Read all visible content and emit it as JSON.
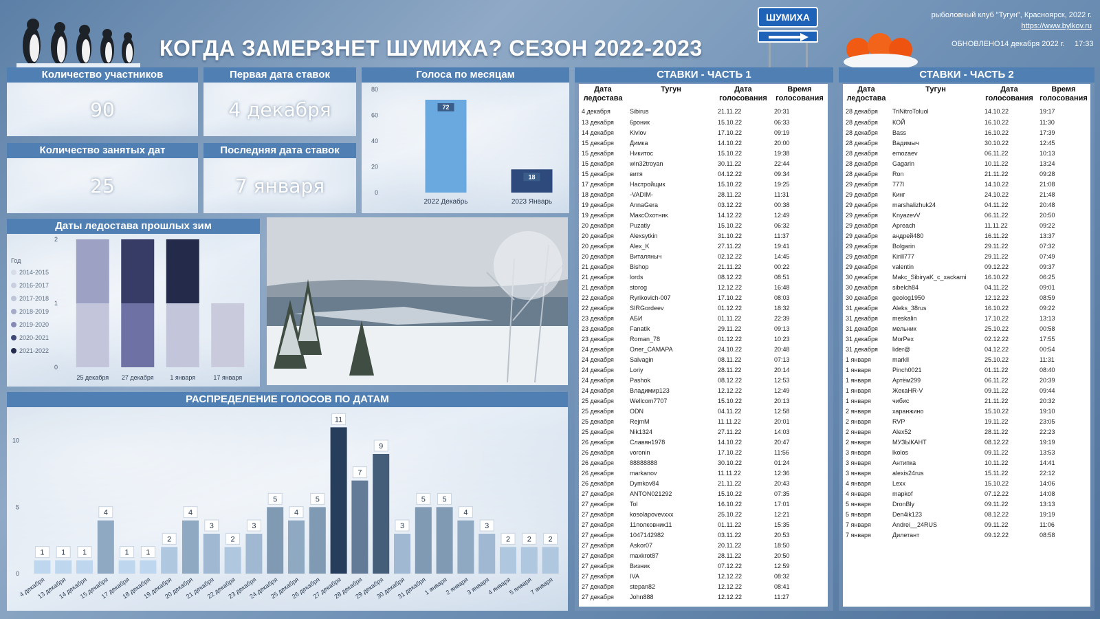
{
  "header": {
    "title": "КОГДА ЗАМЕРЗНЕТ ШУМИХА? СЕЗОН 2022-2023",
    "sign_label": "ШУМИХА",
    "club": "рыболовный клуб \"Тугун\", Красноярск, 2022 г.",
    "site": "https://www.bylkov.ru",
    "updated_label": "ОБНОВЛЕНО",
    "updated_date": "14 декабря 2022 г.",
    "updated_time": "17:33"
  },
  "kpis": {
    "participants_label": "Количество участников",
    "participants_value": "90",
    "first_date_label": "Первая дата ставок",
    "first_date_value": "4 декабря",
    "occupied_label": "Количество занятых дат",
    "occupied_value": "25",
    "last_date_label": "Последняя дата ставок",
    "last_date_value": "7 января"
  },
  "colors": {
    "header_blue": "#4f7fb3",
    "bar_light": "#6aa9e0",
    "bar_dark": "#2e4a7c"
  },
  "chart_data": [
    {
      "type": "bar",
      "title": "Голоса по месяцам",
      "categories": [
        "2022 Декабрь",
        "2023 Январь"
      ],
      "values": [
        72,
        18
      ],
      "ylim": [
        0,
        80
      ],
      "yticks": [
        0,
        20,
        40,
        60,
        80
      ],
      "colors": [
        "#6aa9e0",
        "#2e4a7c"
      ]
    },
    {
      "type": "bar",
      "title": "Даты ледостава прошлых зим",
      "stacked": true,
      "legend_title": "Год",
      "legend": [
        "2014-2015",
        "2016-2017",
        "2017-2018",
        "2018-2019",
        "2019-2020",
        "2020-2021",
        "2021-2022"
      ],
      "legend_colors": [
        "#d7dce6",
        "#c9cfde",
        "#bfc5d8",
        "#a5abc8",
        "#8689b4",
        "#3e4a78",
        "#242c4c"
      ],
      "categories": [
        "25 декабря",
        "27 декабря",
        "1 января",
        "17 января"
      ],
      "segments": [
        [
          {
            "color": "#c3c6da",
            "value": 1
          },
          {
            "color": "#9da1c3",
            "value": 1
          }
        ],
        [
          {
            "color": "#6e71a3",
            "value": 1
          },
          {
            "color": "#363c66",
            "value": 1
          }
        ],
        [
          {
            "color": "#c3c6da",
            "value": 1
          },
          {
            "color": "#232a4a",
            "value": 1
          }
        ],
        [
          {
            "color": "#c9cbdd",
            "value": 1
          }
        ]
      ],
      "ylim": [
        0,
        2
      ],
      "yticks": [
        0,
        1,
        2
      ]
    },
    {
      "type": "bar",
      "title": "РАСПРЕДЕЛЕНИЕ ГОЛОСОВ ПО ДАТАМ",
      "categories": [
        "4 декабря",
        "13 декабря",
        "14 декабря",
        "15 декабря",
        "17 декабря",
        "18 декабря",
        "19 декабря",
        "20 декабря",
        "21 декабря",
        "22 декабря",
        "23 декабря",
        "24 декабря",
        "25 декабря",
        "26 декабря",
        "27 декабря",
        "28 декабря",
        "29 декабря",
        "30 декабря",
        "31 декабря",
        "1 января",
        "2 января",
        "3 января",
        "4 января",
        "5 января",
        "7 января"
      ],
      "values": [
        1,
        1,
        1,
        4,
        1,
        1,
        2,
        4,
        3,
        2,
        3,
        5,
        4,
        5,
        11,
        7,
        9,
        3,
        5,
        5,
        4,
        3,
        2,
        2,
        2
      ],
      "ylim": [
        0,
        12
      ],
      "yticks": [
        0,
        5,
        10
      ]
    }
  ],
  "bets1": {
    "title": "СТАВКИ - ЧАСТЬ 1",
    "col_date": "Дата ледостава",
    "col_name": "Тугун",
    "col_vote": "Дата голосования",
    "col_time": "Время голосования",
    "rows": [
      [
        "4 декабря",
        "Sibirus",
        "21.11.22",
        "20:31"
      ],
      [
        "13 декабря",
        "6роник",
        "15.10.22",
        "06:33"
      ],
      [
        "14 декабря",
        "Kivlov",
        "17.10.22",
        "09:19"
      ],
      [
        "15 декабря",
        "Димка",
        "14.10.22",
        "20:00"
      ],
      [
        "15 декабря",
        "Никитос",
        "15.10.22",
        "19:38"
      ],
      [
        "15 декабря",
        "win32troyan",
        "30.11.22",
        "22:44"
      ],
      [
        "15 декабря",
        "витя",
        "04.12.22",
        "09:34"
      ],
      [
        "17 декабря",
        "Настройщик",
        "15.10.22",
        "19:25"
      ],
      [
        "18 декабря",
        "-VADIM-",
        "28.11.22",
        "11:31"
      ],
      [
        "19 декабря",
        "AnnaGera",
        "03.12.22",
        "00:38"
      ],
      [
        "19 декабря",
        "МаксОхотник",
        "14.12.22",
        "12:49"
      ],
      [
        "20 декабря",
        "Puzatly",
        "15.10.22",
        "06:32"
      ],
      [
        "20 декабря",
        "Alexsytkin",
        "31.10.22",
        "11:37"
      ],
      [
        "20 декабря",
        "Alex_K",
        "27.11.22",
        "19:41"
      ],
      [
        "20 декабря",
        "Виталяныч",
        "02.12.22",
        "14:45"
      ],
      [
        "21 декабря",
        "Bishop",
        "21.11.22",
        "00:22"
      ],
      [
        "21 декабря",
        "lords",
        "08.12.22",
        "08:51"
      ],
      [
        "21 декабря",
        "storog",
        "12.12.22",
        "16:48"
      ],
      [
        "22 декабря",
        "Ryrikovich-007",
        "17.10.22",
        "08:03"
      ],
      [
        "22 декабря",
        "SIRGordeev",
        "01.12.22",
        "18:32"
      ],
      [
        "23 декабря",
        "АБИ",
        "01.11.22",
        "22:39"
      ],
      [
        "23 декабря",
        "Fanatik",
        "29.11.22",
        "09:13"
      ],
      [
        "23 декабря",
        "Roman_78",
        "01.12.22",
        "10:23"
      ],
      [
        "24 декабря",
        "Олег_САМАРА",
        "24.10.22",
        "20:48"
      ],
      [
        "24 декабря",
        "Salvagin",
        "08.11.22",
        "07:13"
      ],
      [
        "24 декабря",
        "Loriy",
        "28.11.22",
        "20:14"
      ],
      [
        "24 декабря",
        "Pashok",
        "08.12.22",
        "12:53"
      ],
      [
        "24 декабря",
        "Владимир123",
        "12.12.22",
        "12:49"
      ],
      [
        "25 декабря",
        "Wellcom7707",
        "15.10.22",
        "20:13"
      ],
      [
        "25 декабря",
        "ODN",
        "04.11.22",
        "12:58"
      ],
      [
        "25 декабря",
        "RejmM",
        "11.11.22",
        "20:01"
      ],
      [
        "25 декабря",
        "Nik1324",
        "27.11.22",
        "14:03"
      ],
      [
        "26 декабря",
        "Славян1978",
        "14.10.22",
        "20:47"
      ],
      [
        "26 декабря",
        "voronin",
        "17.10.22",
        "11:56"
      ],
      [
        "26 декабря",
        "88888888",
        "30.10.22",
        "01:24"
      ],
      [
        "26 декабря",
        "markanov",
        "11.11.22",
        "12:36"
      ],
      [
        "26 декабря",
        "Dymkov84",
        "21.11.22",
        "20:43"
      ],
      [
        "27 декабря",
        "ANTON021292",
        "15.10.22",
        "07:35"
      ],
      [
        "27 декабря",
        "Tol",
        "16.10.22",
        "17:01"
      ],
      [
        "27 декабря",
        "kosolapovevxxx",
        "25.10.22",
        "12:21"
      ],
      [
        "27 декабря",
        "11полковник11",
        "01.11.22",
        "15:35"
      ],
      [
        "27 декабря",
        "1047142982",
        "03.11.22",
        "20:53"
      ],
      [
        "27 декабря",
        "Askor07",
        "20.11.22",
        "18:50"
      ],
      [
        "27 декабря",
        "maxkrot87",
        "28.11.22",
        "20:50"
      ],
      [
        "27 декабря",
        "Визник",
        "07.12.22",
        "12:59"
      ],
      [
        "27 декабря",
        "IVA",
        "12.12.22",
        "08:32"
      ],
      [
        "27 декабря",
        "stepan82",
        "12.12.22",
        "08:41"
      ],
      [
        "27 декабря",
        "John888",
        "12.12.22",
        "11:27"
      ]
    ]
  },
  "bets2": {
    "title": "СТАВКИ - ЧАСТЬ 2",
    "col_date": "Дата ледостава",
    "col_name": "Тугун",
    "col_vote": "Дата голосования",
    "col_time": "Время голосования",
    "rows": [
      [
        "28 декабря",
        "TriNitroToluol",
        "14.10.22",
        "19:17"
      ],
      [
        "28 декабря",
        "КОЙ",
        "16.10.22",
        "11:30"
      ],
      [
        "28 декабря",
        "Bass",
        "16.10.22",
        "17:39"
      ],
      [
        "28 декабря",
        "Вадимыч",
        "30.10.22",
        "12:45"
      ],
      [
        "28 декабря",
        "emozaev",
        "06.11.22",
        "10:13"
      ],
      [
        "28 декабря",
        "Gagarin",
        "10.11.22",
        "13:24"
      ],
      [
        "28 декабря",
        "Ron",
        "21.11.22",
        "09:28"
      ],
      [
        "29 декабря",
        "777l",
        "14.10.22",
        "21:08"
      ],
      [
        "29 декабря",
        "Кинг",
        "24.10.22",
        "21:48"
      ],
      [
        "29 декабря",
        "marshalizhuk24",
        "04.11.22",
        "20:48"
      ],
      [
        "29 декабря",
        "KnyazevV",
        "06.11.22",
        "20:50"
      ],
      [
        "29 декабря",
        "Apreach",
        "11.11.22",
        "09:22"
      ],
      [
        "29 декабря",
        "андрей480",
        "16.11.22",
        "13:37"
      ],
      [
        "29 декабря",
        "Bolgarin",
        "29.11.22",
        "07:32"
      ],
      [
        "29 декабря",
        "Kirill777",
        "29.11.22",
        "07:49"
      ],
      [
        "29 декабря",
        "valentin",
        "09.12.22",
        "09:37"
      ],
      [
        "30 декабря",
        "Makc_SibiryaK_c_xackami",
        "16.10.22",
        "06:25"
      ],
      [
        "30 декабря",
        "sibelch84",
        "04.11.22",
        "09:01"
      ],
      [
        "30 декабря",
        "geolog1950",
        "12.12.22",
        "08:59"
      ],
      [
        "31 декабря",
        "Aleks_38rus",
        "16.10.22",
        "09:22"
      ],
      [
        "31 декабря",
        "meskalin",
        "17.10.22",
        "13:13"
      ],
      [
        "31 декабря",
        "мельник",
        "25.10.22",
        "00:58"
      ],
      [
        "31 декабря",
        "MorPex",
        "02.12.22",
        "17:55"
      ],
      [
        "31 декабря",
        "lider@",
        "04.12.22",
        "00:54"
      ],
      [
        "1 января",
        "markll",
        "25.10.22",
        "11:31"
      ],
      [
        "1 января",
        "Pinch0021",
        "01.11.22",
        "08:40"
      ],
      [
        "1 января",
        "Артём299",
        "06.11.22",
        "20:39"
      ],
      [
        "1 января",
        "ЖекаHR-V",
        "09.11.22",
        "09:44"
      ],
      [
        "1 января",
        "чибис",
        "21.11.22",
        "20:32"
      ],
      [
        "2 января",
        "харанжино",
        "15.10.22",
        "19:10"
      ],
      [
        "2 января",
        "RVP",
        "19.11.22",
        "23:05"
      ],
      [
        "2 января",
        "Alex52",
        "28.11.22",
        "22:23"
      ],
      [
        "2 января",
        "МУЗЫКАНТ",
        "08.12.22",
        "19:19"
      ],
      [
        "3 января",
        "lkolos",
        "09.11.22",
        "13:53"
      ],
      [
        "3 января",
        "Антипка",
        "10.11.22",
        "14:41"
      ],
      [
        "3 января",
        "alexis24rus",
        "15.11.22",
        "22:12"
      ],
      [
        "4 января",
        "Lexx",
        "15.10.22",
        "14:06"
      ],
      [
        "4 января",
        "mapkof",
        "07.12.22",
        "14:08"
      ],
      [
        "5 января",
        "DronBly",
        "09.11.22",
        "13:13"
      ],
      [
        "5 января",
        "Den4ik123",
        "08.12.22",
        "19:19"
      ],
      [
        "7 января",
        "Andrei__24RUS",
        "09.11.22",
        "11:06"
      ],
      [
        "7 января",
        "Дилетант",
        "09.12.22",
        "08:58"
      ]
    ]
  }
}
